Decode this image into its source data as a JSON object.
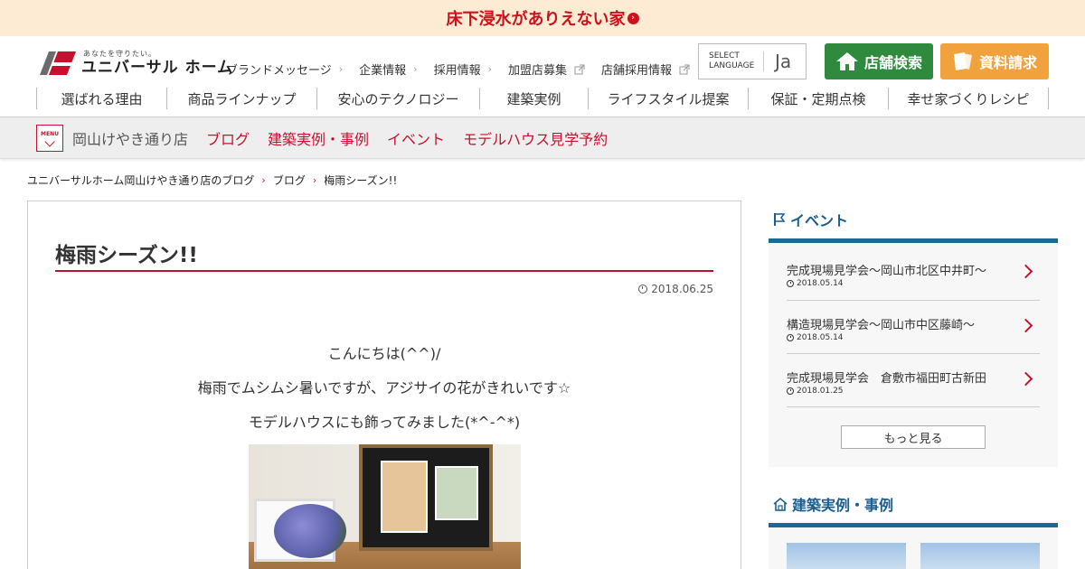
{
  "topbar": {
    "promo": "床下浸水がありえない家"
  },
  "logo": {
    "tagline": "あなたを守りたい。",
    "name": "ユニバーサル ホーム"
  },
  "util_nav": [
    {
      "label": "ブランドメッセージ",
      "kind": "arrow"
    },
    {
      "label": "企業情報",
      "kind": "arrow"
    },
    {
      "label": "採用情報",
      "kind": "arrow"
    },
    {
      "label": "加盟店募集",
      "kind": "external"
    },
    {
      "label": "店舗採用情報",
      "kind": "external"
    }
  ],
  "language": {
    "label": "SELECT LANGUAGE",
    "value": "Ja"
  },
  "header_buttons": {
    "store_search": "店舗検索",
    "request_docs": "資料請求"
  },
  "main_nav": [
    "選ばれる理由",
    "商品ラインナップ",
    "安心のテクノロジー",
    "建築実例",
    "ライフスタイル提案",
    "保証・定期点検",
    "幸せ家づくりレシピ"
  ],
  "sub_header": {
    "menu_label": "MENU",
    "store_name": "岡山けやき通り店",
    "links": [
      "ブログ",
      "建築実例・事例",
      "イベント",
      "モデルハウス見学予約"
    ]
  },
  "breadcrumb": [
    "ユニバーサルホーム岡山けやき通り店のブログ",
    "ブログ",
    "梅雨シーズン!!"
  ],
  "article": {
    "title": "梅雨シーズン!!",
    "date": "2018.06.25",
    "paragraphs": [
      "こんにちは(^^)/",
      "梅雨でムシムシ暑いですが、アジサイの花がきれいです☆",
      "モデルハウスにも飾ってみました(*^-^*)"
    ]
  },
  "sidebar": {
    "events_heading": "イベント",
    "events": [
      {
        "title": "完成現場見学会～岡山市北区中井町～",
        "date": "2018.05.14"
      },
      {
        "title": "構造現場見学会～岡山市中区藤崎～",
        "date": "2018.05.14"
      },
      {
        "title": "完成現場見学会　倉敷市福田町古新田",
        "date": "2018.01.25"
      }
    ],
    "more_label": "もっと見る",
    "cases_heading": "建築実例・事例"
  },
  "colors": {
    "accent_red": "#c8102e",
    "promo_bg": "#fdebd3",
    "store_green": "#2f8a3e",
    "doc_orange": "#f2a23c",
    "side_blue": "#1a6a94"
  }
}
